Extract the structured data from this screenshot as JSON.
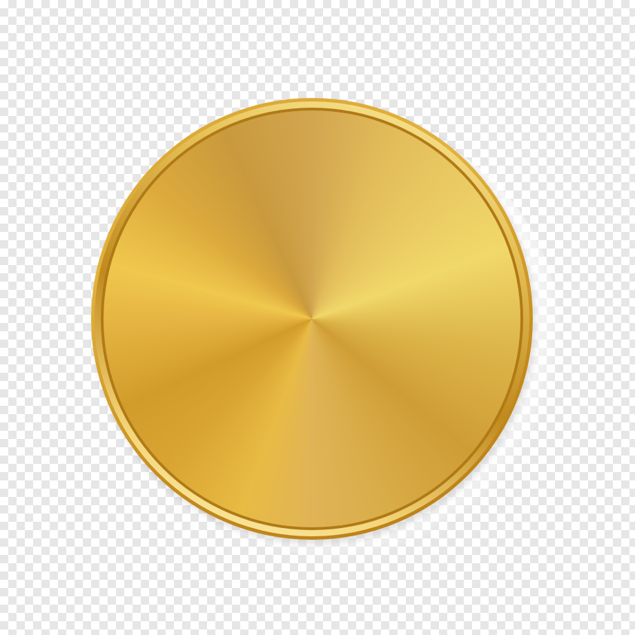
{
  "image": {
    "subject": "gold-coin",
    "colors": {
      "rim_light": "#fff1a8",
      "rim_dark": "#b07a16",
      "face_light": "#f1d86a",
      "face_mid": "#e0b456",
      "face_dark": "#c99a3d",
      "checker_light": "#ffffff",
      "checker_dark": "#e6e6e6"
    }
  }
}
